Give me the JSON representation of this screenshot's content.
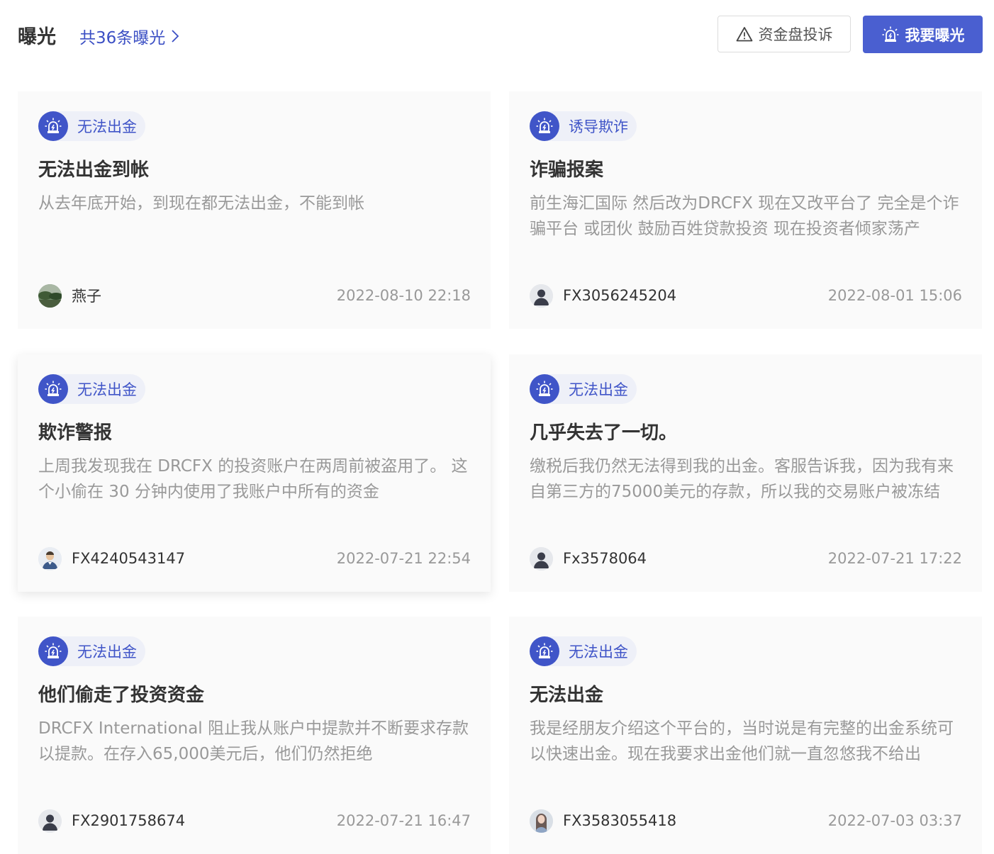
{
  "header": {
    "title": "曝光",
    "count_link": "共36条曝光",
    "complaint_button": "资金盘投诉",
    "expose_button": "我要曝光"
  },
  "cards": [
    {
      "tag": "无法出金",
      "title": "无法出金到帐",
      "body": "从去年底开始，到现在都无法出金，不能到帐",
      "user": "燕子",
      "date": "2022-08-10 22:18",
      "avatar": "landscape-photo-avatar"
    },
    {
      "tag": "诱导欺诈",
      "title": "诈骗报案",
      "body": "前生海汇国际 然后改为DRCFX 现在又改平台了 完全是个诈骗平台 或团伙 鼓励百姓贷款投资 现在投资者倾家荡产",
      "user": "FX3056245204",
      "date": "2022-08-01 15:06",
      "avatar": "default-user-avatar"
    },
    {
      "tag": "无法出金",
      "title": "欺诈警报",
      "body": "上周我发现我在 DRCFX 的投资账户在两周前被盗用了。 这个小偷在 30 分钟内使用了我账户中所有的资金",
      "user": "FX4240543147",
      "date": "2022-07-21 22:54",
      "avatar": "man-avatar"
    },
    {
      "tag": "无法出金",
      "title": "几乎失去了一切。",
      "body": "缴税后我仍然无法得到我的出金。客服告诉我，因为我有来自第三方的75000美元的存款，所以我的交易账户被冻结",
      "user": "Fx3578064",
      "date": "2022-07-21 17:22",
      "avatar": "default-user-avatar"
    },
    {
      "tag": "无法出金",
      "title": "他们偷走了投资资金",
      "body": "DRCFX International 阻止我从账户中提款并不断要求存款以提款。在存入65,000美元后，他们仍然拒绝",
      "user": "FX2901758674",
      "date": "2022-07-21 16:47",
      "avatar": "default-user-avatar"
    },
    {
      "tag": "无法出金",
      "title": "无法出金",
      "body": "我是经朋友介绍这个平台的，当时说是有完整的出金系统可以快速出金。现在我要求出金他们就一直忽悠我不给出",
      "user": "FX3583055418",
      "date": "2022-07-03 03:37",
      "avatar": "woman-photo-avatar"
    }
  ]
}
